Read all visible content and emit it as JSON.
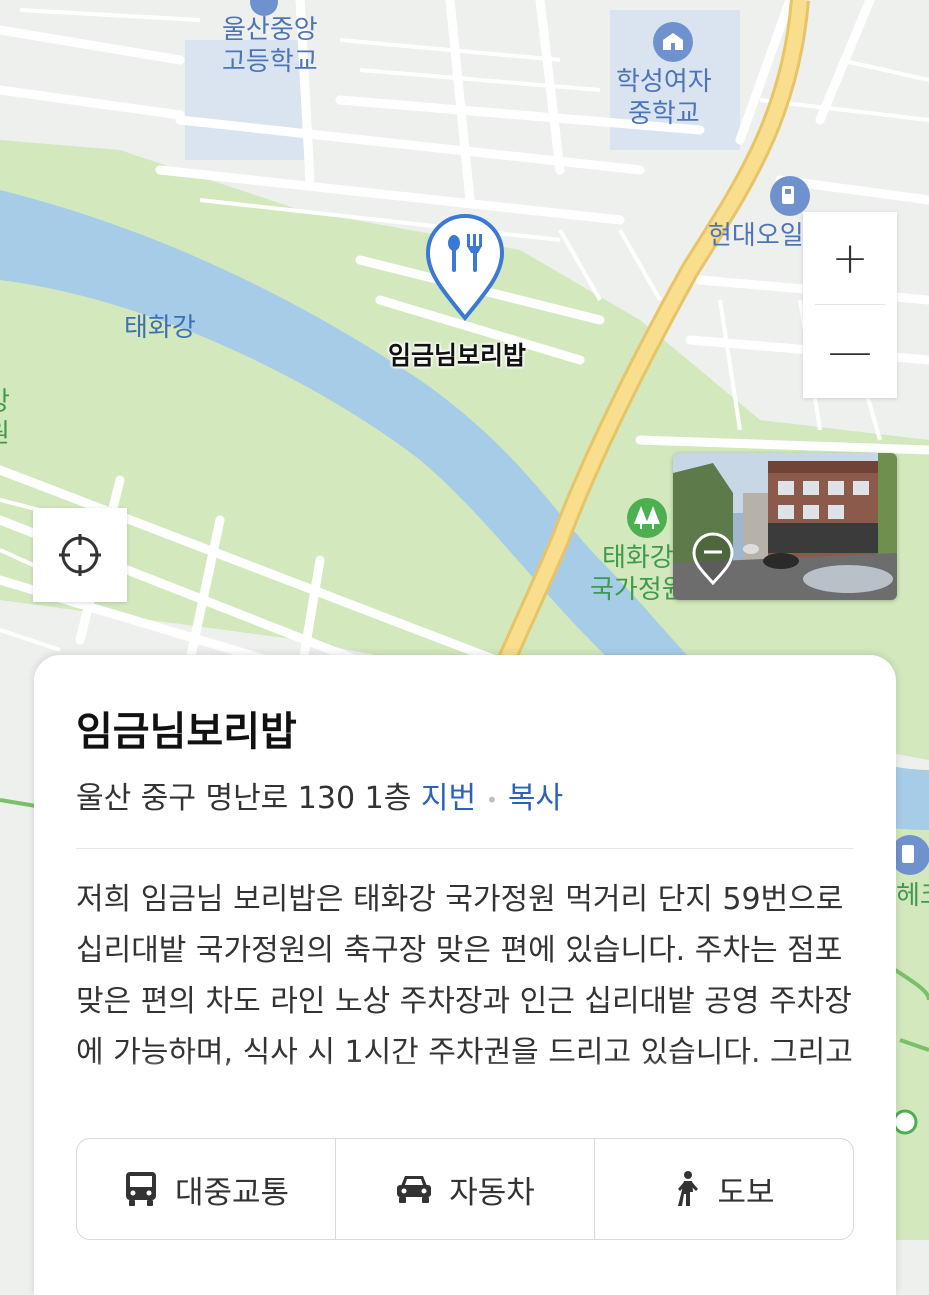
{
  "map": {
    "labels": {
      "school_1": "울산중앙\n고등학교",
      "school_2": "학성여자\n중학교",
      "gas_station": "현대오일뱅크",
      "river": "태화강",
      "park": "태화강\n국가정원",
      "park_edge": "강\n원",
      "right_edge": "헤크"
    },
    "poi_icons": [
      "school-icon",
      "school-icon",
      "gas-station-icon",
      "park-icon"
    ],
    "colors": {
      "land": "#eef0ee",
      "park": "#cfe5b8",
      "river": "#a6cce8",
      "road": "#ffffff",
      "main_road": "#f6db83",
      "accent_blue": "#2a63b8",
      "marker_blue": "#3a79d6"
    },
    "marker": {
      "name": "임금님보리밥",
      "icon": "restaurant-fork-spoon-icon"
    },
    "controls": {
      "zoom_in": "+",
      "zoom_out": "—",
      "locate_icon": "crosshair-icon",
      "roadview_icon": "roadview-pin-icon"
    }
  },
  "place_card": {
    "name": "임금님보리밥",
    "address": "울산 중구 명난로 130 1층",
    "jibun_label": "지번",
    "separator": "•",
    "copy_label": "복사",
    "description": "저희 임금님 보리밥은 태화강 국가정원 먹거리 단지 59번으로 십리대밭 국가정원의 축구장 맞은 편에 있습니다. 주차는 점포 맞은 편의 차도 라인 노상 주차장과 인근 십리대밭 공영 주차장에 가능하며, 식사 시 1시간 주차권을 드리고 있습니다. 그리고 주메뉴인 보리밥으로 내리",
    "nav": [
      {
        "label": "대중교통",
        "icon": "bus-icon"
      },
      {
        "label": "자동차",
        "icon": "car-icon"
      },
      {
        "label": "도보",
        "icon": "walk-icon"
      }
    ]
  }
}
